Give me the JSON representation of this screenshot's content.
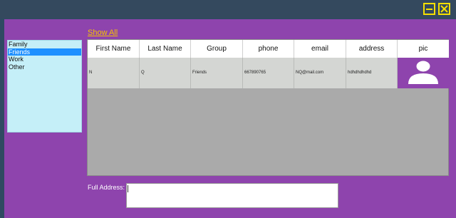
{
  "window": {
    "minimize_icon": "minimize-icon",
    "close_icon": "close-icon",
    "accent_color": "#f5e000"
  },
  "toolbar": {
    "show_all_label": "Show All"
  },
  "groups": [
    "Family",
    "Friends",
    "Work",
    "Other"
  ],
  "selected_group": "Friends",
  "table": {
    "columns": [
      "First Name",
      "Last Name",
      "Group",
      "phone",
      "email",
      "address",
      "pic"
    ],
    "rows": [
      {
        "first_name": "N",
        "last_name": "Q",
        "group": "Friends",
        "phone": "667890765",
        "email": "NQ@mail.com",
        "address": "hdhdhdhdhd",
        "pic_icon": "user-avatar-icon"
      }
    ]
  },
  "details": {
    "full_address_label": "Full Address:",
    "full_address_value": ""
  },
  "colors": {
    "panel": "#8e44ad",
    "titlebar": "#34495e",
    "link": "#f5c400",
    "list_bg": "#c5eff8",
    "list_selected": "#1e90ff",
    "grid_bg": "#aaaaaa",
    "row_bg": "#d4d6d3"
  }
}
